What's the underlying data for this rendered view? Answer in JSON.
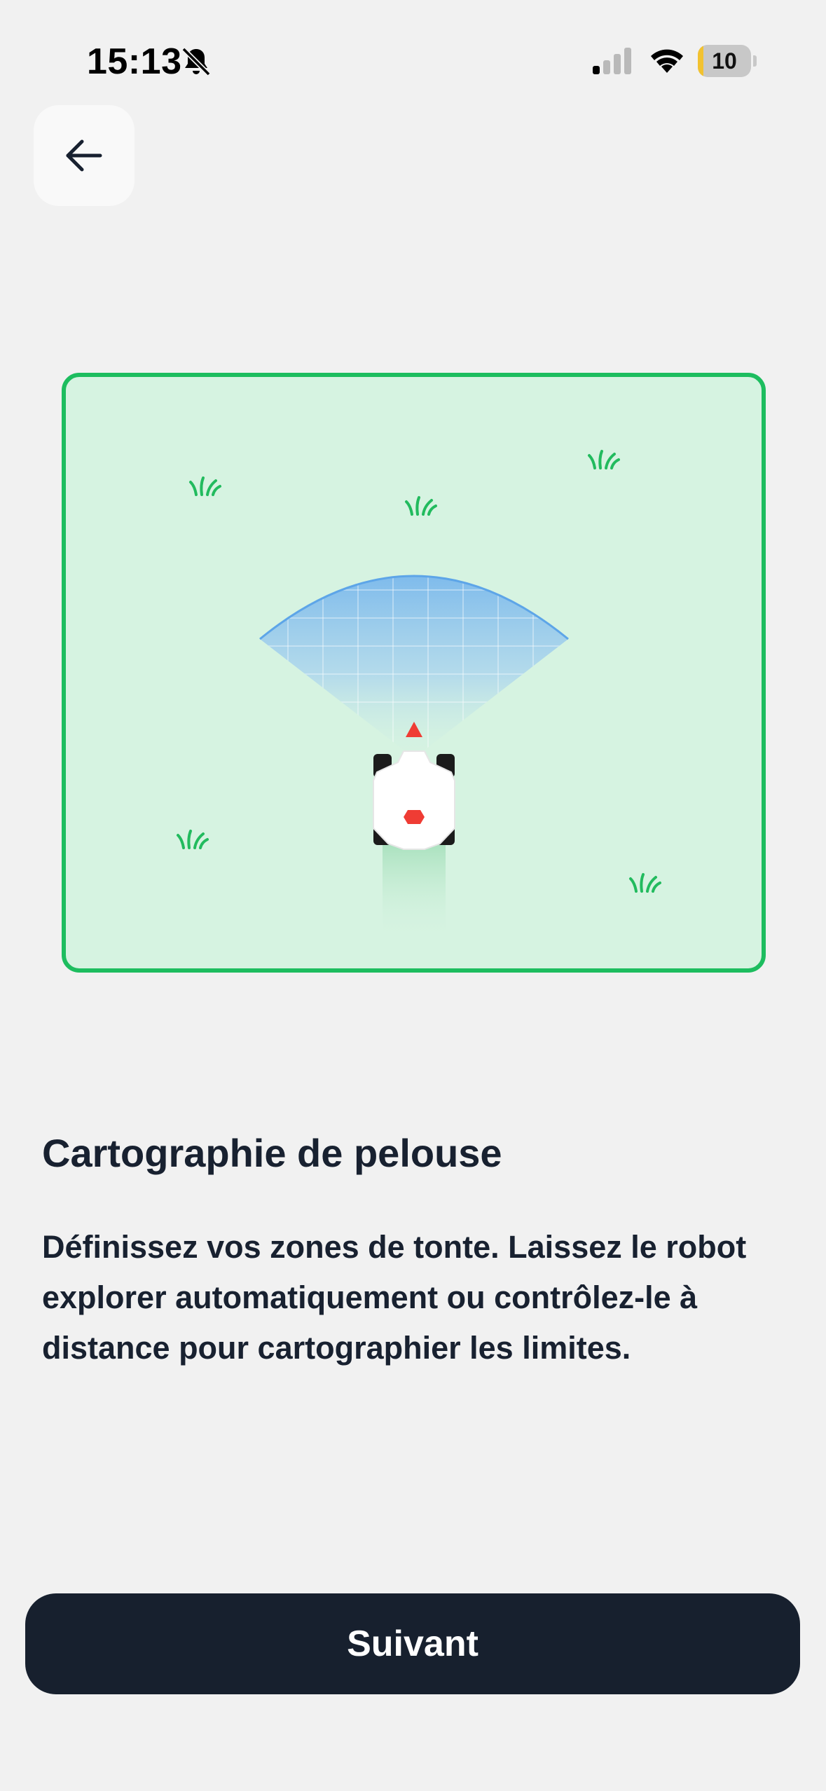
{
  "status_bar": {
    "time": "15:13",
    "battery_level": "10",
    "battery_fraction": 0.1,
    "icons": [
      "bell-slash-icon",
      "cellular-signal-icon",
      "wifi-icon",
      "battery-icon"
    ]
  },
  "header": {
    "back_icon": "arrow-left-icon"
  },
  "content": {
    "title": "Cartographie de pelouse",
    "description": "Définissez vos zones de tonte. Laissez le robot explorer automatiquement ou contrôlez-le à distance pour cartographier les limites."
  },
  "footer": {
    "next_label": "Suivant"
  },
  "colors": {
    "background": "#f1f1f1",
    "lawn_fill": "#d6f3e1",
    "lawn_border": "#1dbd5f",
    "button_dark": "#17202e",
    "scan_blue": "#7ab8ec",
    "robot_accent": "#ef3c34"
  }
}
